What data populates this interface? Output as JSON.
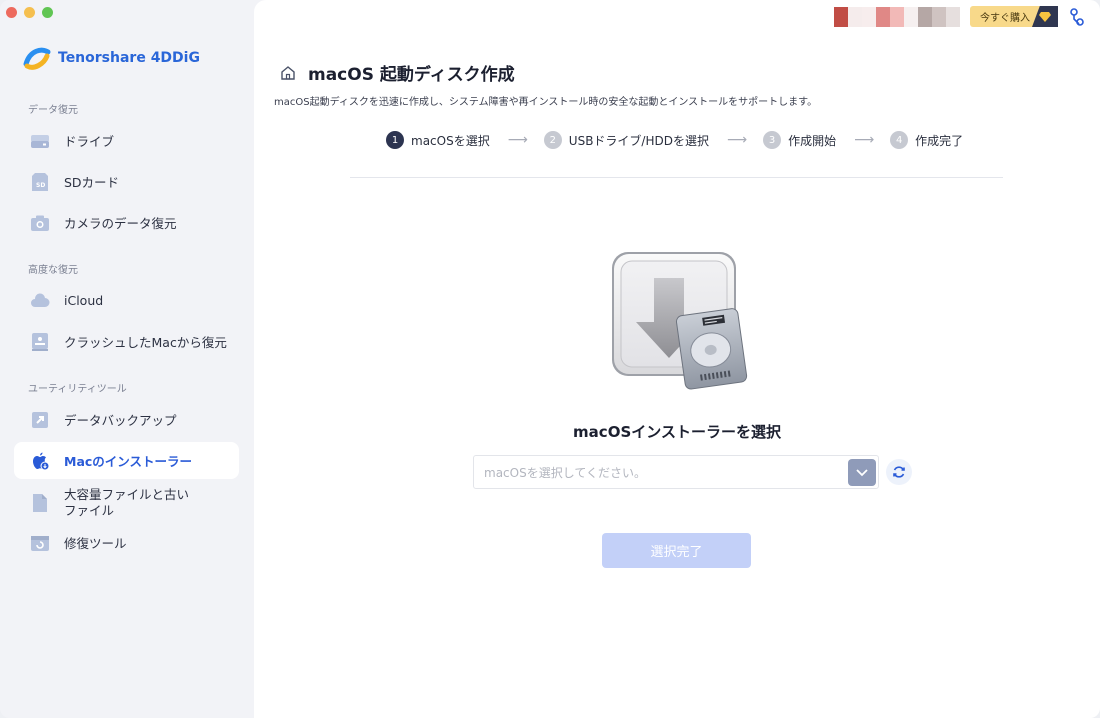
{
  "app": {
    "brand_name": "Tenorshare 4DDiG",
    "accent_color": "#2a5bd7"
  },
  "sidebar": {
    "sections": [
      {
        "label": "データ復元",
        "items": [
          {
            "label": "ドライブ",
            "icon": "drive-icon"
          },
          {
            "label": "SDカード",
            "icon": "sd-card-icon"
          },
          {
            "label": "カメラのデータ復元",
            "icon": "camera-icon"
          }
        ]
      },
      {
        "label": "高度な復元",
        "items": [
          {
            "label": "iCloud",
            "icon": "cloud-icon"
          },
          {
            "label": "クラッシュしたMacから復元",
            "icon": "crashed-mac-icon"
          }
        ]
      },
      {
        "label": "ユーティリティツール",
        "items": [
          {
            "label": "データバックアップ",
            "icon": "backup-icon"
          },
          {
            "label": "Macのインストーラー",
            "icon": "apple-icon",
            "active": true
          },
          {
            "label": "大容量ファイルと古い",
            "label_line2": "ファイル",
            "icon": "file-icon"
          },
          {
            "label": "修復ツール",
            "icon": "repair-icon"
          }
        ]
      }
    ]
  },
  "topbar": {
    "buy_label": "今すぐ購入"
  },
  "main": {
    "title": "macOS 起動ディスク作成",
    "description": "macOS起動ディスクを迅速に作成し、システム障害や再インストール時の安全な起動とインストールをサポートします。",
    "steps": [
      {
        "num": "1",
        "label": "macOSを選択",
        "current": true
      },
      {
        "num": "2",
        "label": "USBドライブ/HDDを選択"
      },
      {
        "num": "3",
        "label": "作成開始"
      },
      {
        "num": "4",
        "label": "作成完了"
      }
    ],
    "select_title": "macOSインストーラーを選択",
    "select_placeholder": "macOSを選択してください。",
    "confirm_label": "選択完了"
  }
}
